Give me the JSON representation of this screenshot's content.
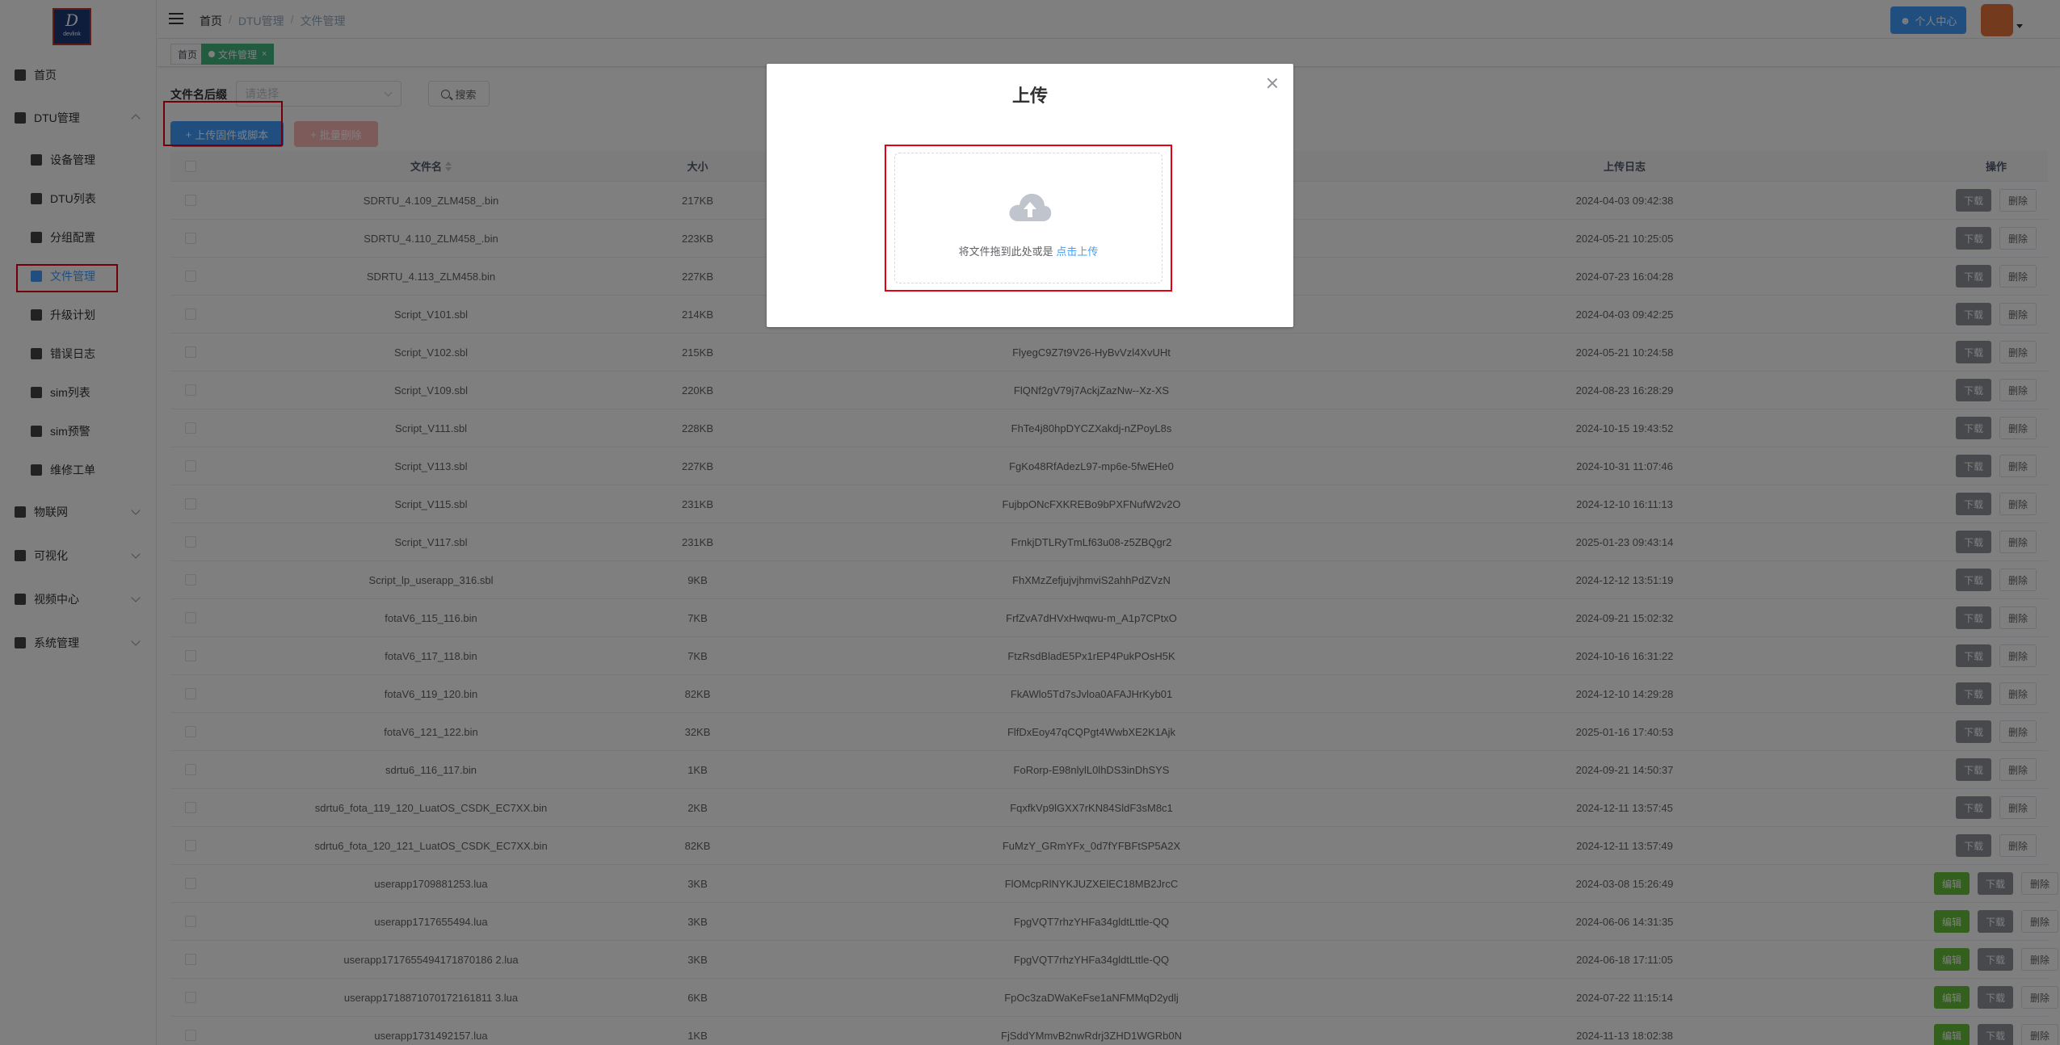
{
  "logo": {
    "letter": "D",
    "sub": "devlink"
  },
  "sidebar": {
    "items": [
      {
        "label": "首页",
        "icon": "speedometer-icon",
        "level": "top"
      },
      {
        "label": "DTU管理",
        "icon": "terminal-icon",
        "level": "top",
        "expanded": true
      },
      {
        "label": "设备管理",
        "icon": "edit-document-icon",
        "level": "sub"
      },
      {
        "label": "DTU列表",
        "icon": "list-icon",
        "level": "sub"
      },
      {
        "label": "分组配置",
        "icon": "monitor-icon",
        "level": "sub"
      },
      {
        "label": "文件管理",
        "icon": "folder-icon",
        "level": "sub",
        "active": true
      },
      {
        "label": "升级计划",
        "icon": "cloud-upload-icon",
        "level": "sub"
      },
      {
        "label": "错误日志",
        "icon": "log-icon",
        "level": "sub"
      },
      {
        "label": "sim列表",
        "icon": "mail-icon",
        "level": "sub"
      },
      {
        "label": "sim预警",
        "icon": "alert-icon",
        "level": "sub"
      },
      {
        "label": "维修工单",
        "icon": "wrench-icon",
        "level": "sub"
      },
      {
        "label": "物联网",
        "icon": "grid-icon",
        "level": "top"
      },
      {
        "label": "可视化",
        "icon": "chart-icon",
        "level": "top"
      },
      {
        "label": "视频中心",
        "icon": "video-icon",
        "level": "top"
      },
      {
        "label": "系统管理",
        "icon": "gear-icon",
        "level": "top"
      }
    ]
  },
  "header": {
    "breadcrumb": [
      "首页",
      "DTU管理",
      "文件管理"
    ],
    "user_button": "个人中心"
  },
  "tags": [
    {
      "label": "首页",
      "active": false
    },
    {
      "label": "文件管理",
      "active": true
    }
  ],
  "search": {
    "label": "文件名后缀",
    "placeholder": "请选择",
    "button": "搜索"
  },
  "toolbar": {
    "upload": "上传固件或脚本",
    "batch_delete": "批量删除"
  },
  "table": {
    "headers": {
      "name": "文件名",
      "size": "大小",
      "date": "上传日志",
      "ops": "操作"
    },
    "ops_labels": {
      "edit": "编辑",
      "download": "下载",
      "delete": "删除"
    },
    "rows": [
      {
        "name": "SDRTU_4.109_ZLM458_.bin",
        "size": "217KB",
        "key": "",
        "date": "2024-04-03 09:42:38",
        "editable": false
      },
      {
        "name": "SDRTU_4.110_ZLM458_.bin",
        "size": "223KB",
        "key": "",
        "date": "2024-05-21 10:25:05",
        "editable": false
      },
      {
        "name": "SDRTU_4.113_ZLM458.bin",
        "size": "227KB",
        "key": "",
        "date": "2024-07-23 16:04:28",
        "editable": false
      },
      {
        "name": "Script_V101.sbl",
        "size": "214KB",
        "key": "",
        "date": "2024-04-03 09:42:25",
        "editable": false
      },
      {
        "name": "Script_V102.sbl",
        "size": "215KB",
        "key": "FlyegC9Z7t9V26-HyBvVzl4XvUHt",
        "date": "2024-05-21 10:24:58",
        "editable": false
      },
      {
        "name": "Script_V109.sbl",
        "size": "220KB",
        "key": "FlQNf2gV79j7AckjZazNw--Xz-XS",
        "date": "2024-08-23 16:28:29",
        "editable": false
      },
      {
        "name": "Script_V111.sbl",
        "size": "228KB",
        "key": "FhTe4j80hpDYCZXakdj-nZPoyL8s",
        "date": "2024-10-15 19:43:52",
        "editable": false
      },
      {
        "name": "Script_V113.sbl",
        "size": "227KB",
        "key": "FgKo48RfAdezL97-mp6e-5fwEHe0",
        "date": "2024-10-31 11:07:46",
        "editable": false
      },
      {
        "name": "Script_V115.sbl",
        "size": "231KB",
        "key": "FujbpONcFXKREBo9bPXFNufW2v2O",
        "date": "2024-12-10 16:11:13",
        "editable": false
      },
      {
        "name": "Script_V117.sbl",
        "size": "231KB",
        "key": "FrnkjDTLRyTmLf63u08-z5ZBQgr2",
        "date": "2025-01-23 09:43:14",
        "editable": false
      },
      {
        "name": "Script_lp_userapp_316.sbl",
        "size": "9KB",
        "key": "FhXMzZefjujvjhmviS2ahhPdZVzN",
        "date": "2024-12-12 13:51:19",
        "editable": false
      },
      {
        "name": "fotaV6_115_116.bin",
        "size": "7KB",
        "key": "FrfZvA7dHVxHwqwu-m_A1p7CPtxO",
        "date": "2024-09-21 15:02:32",
        "editable": false
      },
      {
        "name": "fotaV6_117_118.bin",
        "size": "7KB",
        "key": "FtzRsdBladE5Px1rEP4PukPOsH5K",
        "date": "2024-10-16 16:31:22",
        "editable": false
      },
      {
        "name": "fotaV6_119_120.bin",
        "size": "82KB",
        "key": "FkAWlo5Td7sJvloa0AFAJHrKyb01",
        "date": "2024-12-10 14:29:28",
        "editable": false
      },
      {
        "name": "fotaV6_121_122.bin",
        "size": "32KB",
        "key": "FlfDxEoy47qCQPgt4WwbXE2K1Ajk",
        "date": "2025-01-16 17:40:53",
        "editable": false
      },
      {
        "name": "sdrtu6_116_117.bin",
        "size": "1KB",
        "key": "FoRorp-E98nlylL0lhDS3inDhSYS",
        "date": "2024-09-21 14:50:37",
        "editable": false
      },
      {
        "name": "sdrtu6_fota_119_120_LuatOS_CSDK_EC7XX.bin",
        "size": "2KB",
        "key": "FqxfkVp9lGXX7rKN84SldF3sM8c1",
        "date": "2024-12-11 13:57:45",
        "editable": false
      },
      {
        "name": "sdrtu6_fota_120_121_LuatOS_CSDK_EC7XX.bin",
        "size": "82KB",
        "key": "FuMzY_GRmYFx_0d7fYFBFtSP5A2X",
        "date": "2024-12-11 13:57:49",
        "editable": false
      },
      {
        "name": "userapp1709881253.lua",
        "size": "3KB",
        "key": "FlOMcpRlNYKJUZXElEC18MB2JrcC",
        "date": "2024-03-08 15:26:49",
        "editable": true
      },
      {
        "name": "userapp1717655494.lua",
        "size": "3KB",
        "key": "FpgVQT7rhzYHFa34gldtLttle-QQ",
        "date": "2024-06-06 14:31:35",
        "editable": true
      },
      {
        "name": "userapp1717655494171870186 2.lua",
        "size": "3KB",
        "key": "FpgVQT7rhzYHFa34gldtLttle-QQ",
        "date": "2024-06-18 17:11:05",
        "editable": true
      },
      {
        "name": "userapp1718871070172161811 3.lua",
        "size": "6KB",
        "key": "FpOc3zaDWaKeFse1aNFMMqD2ydlj",
        "date": "2024-07-22 11:15:14",
        "editable": true
      },
      {
        "name": "userapp1731492157.lua",
        "size": "1KB",
        "key": "FjSddYMmvB2nwRdrj3ZHD1WGRb0N",
        "date": "2024-11-13 18:02:38",
        "editable": true
      }
    ]
  },
  "dialog": {
    "title": "上传",
    "drop_text": "将文件拖到此处或是",
    "drop_link": "点击上传"
  },
  "colors": {
    "primary": "#409eff",
    "success": "#67c23a",
    "danger_light": "#fab6b6",
    "highlight": "#e60012"
  }
}
